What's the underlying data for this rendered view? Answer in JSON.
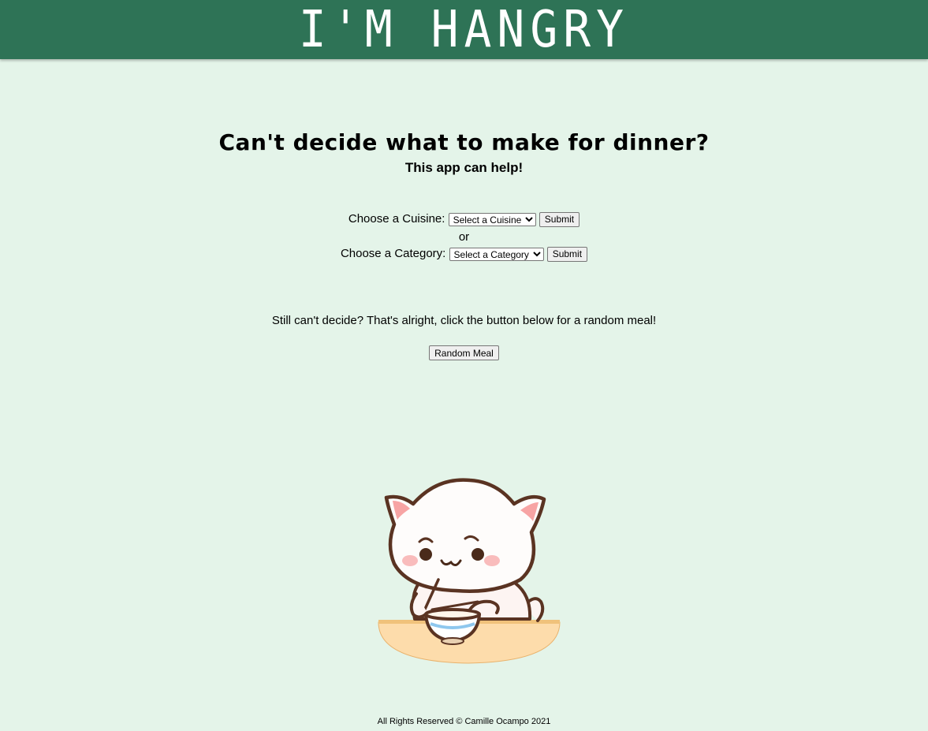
{
  "header": {
    "title": "I'M HANGRY",
    "background_color": "#2e7356"
  },
  "main": {
    "headline": "Can't decide what to make for dinner?",
    "subhead": "This app can help!",
    "cuisine": {
      "label": "Choose a Cuisine:",
      "select_value": "Select a Cuisine",
      "submit_label": "Submit"
    },
    "separator": "or",
    "category": {
      "label": "Choose a Category:",
      "select_value": "Select a Category",
      "submit_label": "Submit"
    },
    "random_prompt": "Still can't decide? That's alright, click the button below for a random meal!",
    "random_button_label": "Random Meal",
    "background_color": "#e4f4e9"
  },
  "footer": {
    "text": "All Rights Reserved © Camille Ocampo 2021"
  }
}
